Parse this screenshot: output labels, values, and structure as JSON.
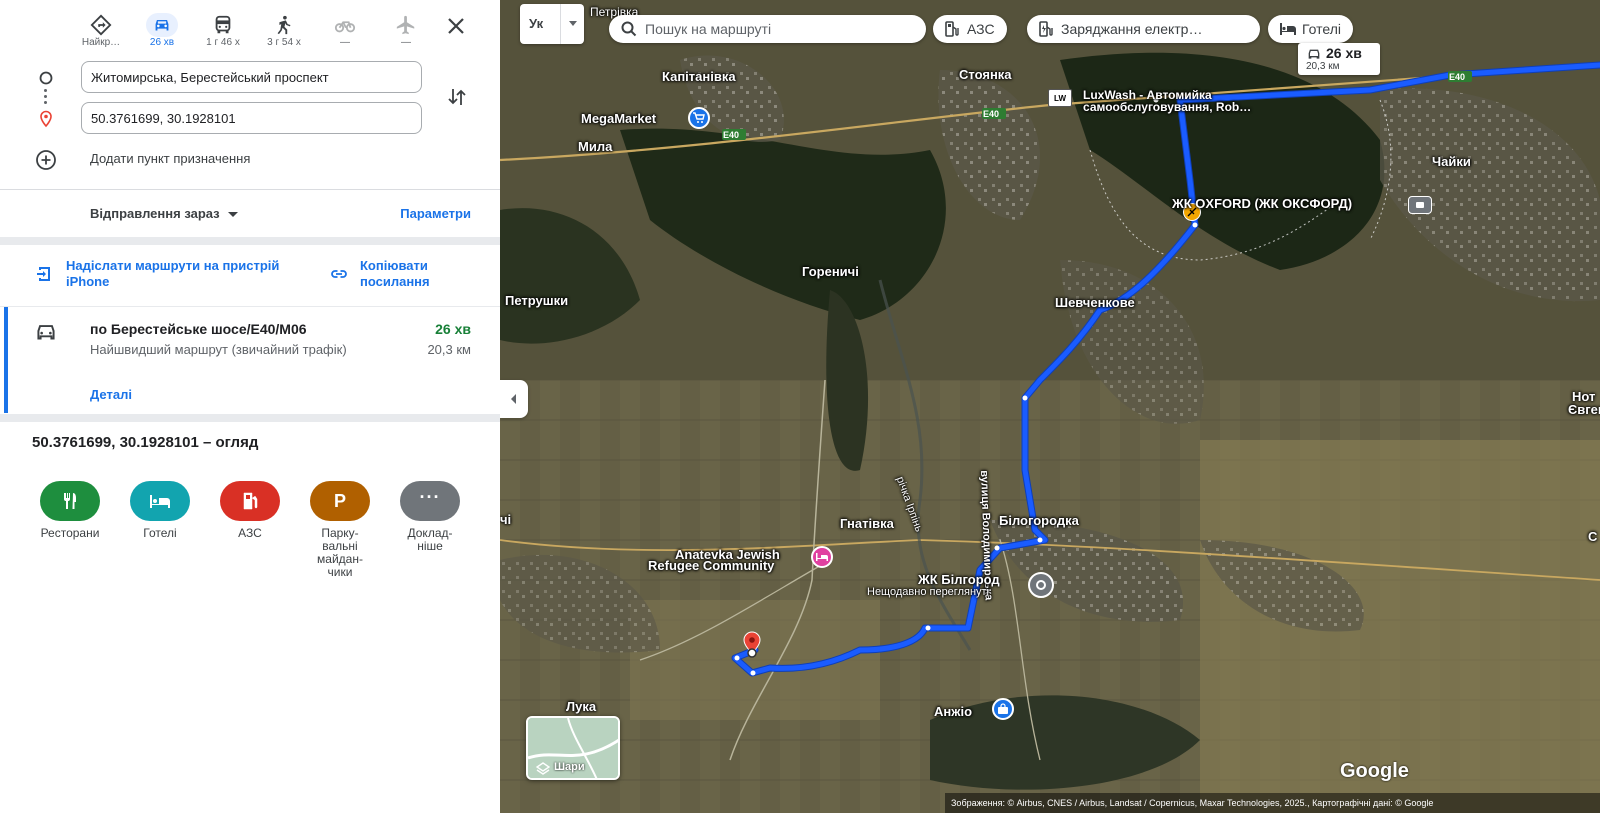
{
  "modes": [
    {
      "name": "best",
      "label": "Найкр…",
      "active": false,
      "disabled": false
    },
    {
      "name": "car",
      "label": "26 хв",
      "active": true,
      "disabled": false
    },
    {
      "name": "transit",
      "label": "1 г 46 х",
      "active": false,
      "disabled": false
    },
    {
      "name": "walk",
      "label": "3 г 54 х",
      "active": false,
      "disabled": false
    },
    {
      "name": "bike",
      "label": "—",
      "active": false,
      "disabled": true
    },
    {
      "name": "flight",
      "label": "—",
      "active": false,
      "disabled": true
    }
  ],
  "origin": {
    "value": "Житомирська, Берестейський проспект"
  },
  "destination": {
    "value": "50.3761699, 30.1928101"
  },
  "add_destination": "Додати пункт призначення",
  "depart_label": "Відправлення зараз",
  "params_label": "Параметри",
  "send_to_phone": "Надіслати маршрути на пристрій iPhone",
  "copy_link": "Копіювати посилання",
  "route": {
    "title": "по Берестейське шосе/E40/M06",
    "time": "26 хв",
    "subtitle": "Найшвидший маршрут (звичайний трафік)",
    "distance": "20,3 км",
    "details": "Деталі"
  },
  "overview_title": "50.3761699, 30.1928101 – огляд",
  "categories": [
    {
      "label": "Ресторани",
      "color": "#1e8e3e",
      "icon": "restaurant-icon"
    },
    {
      "label": "Готелі",
      "color": "#12a4af",
      "icon": "hotel-icon"
    },
    {
      "label": "АЗС",
      "color": "#d93025",
      "icon": "gas-station-icon"
    },
    {
      "label": "Парку-вальні майдан-чики",
      "color": "#b06000",
      "icon": "parking-icon"
    },
    {
      "label": "Доклад-ніше",
      "color": "#70757a",
      "icon": "more-icon"
    }
  ],
  "map": {
    "lang": "Ук",
    "search_placeholder": "Пошук на маршруті",
    "chips": [
      "АЗС",
      "Заряджання електр…",
      "Готелі"
    ],
    "callout_time": "26 хв",
    "callout_dist": "20,3 км",
    "labels": {
      "kapitanivka": "Капітанівка",
      "stoyanka": "Стоянка",
      "megamarket": "MegaMarket",
      "mylа": "Мила",
      "luxwash1": "LuxWash - Автомийка",
      "luxwash2": "самообслуговування, Rob…",
      "chaiky": "Чайки",
      "oxford": "ЖК OXFORD (ЖК ОКСФОРД)",
      "horenychi": "Гореничі",
      "petrushky": "Петрушки",
      "shevchenkove": "Шевченкове",
      "volodymyrska": "вулиця Володимирська",
      "bilohorodka": "Білогородка",
      "hnativka": "Гнатівка",
      "anatevka1": "Anatevka Jewish",
      "anatevka2": "Refugee Community",
      "bilhorod": "ЖК Білгород",
      "recent": "Нещодавно переглянуті",
      "luka": "Лука",
      "anzhio": "Анжіо",
      "river": "річка Ірпінь",
      "e40_a": "E40",
      "e40_b": "E40",
      "e40_c": "E40",
      "petrivka": "Петрівка",
      "right1": "Нот",
      "right2": "Євген",
      "left_edge": "чі",
      "right_edge": "С"
    },
    "layers_label": "Шари",
    "logo": "Google",
    "attribution": "Зображення: © Airbus, CNES / Airbus, Landsat / Copernicus, Maxar Technologies, 2025., Картографічні дані: © Google"
  }
}
